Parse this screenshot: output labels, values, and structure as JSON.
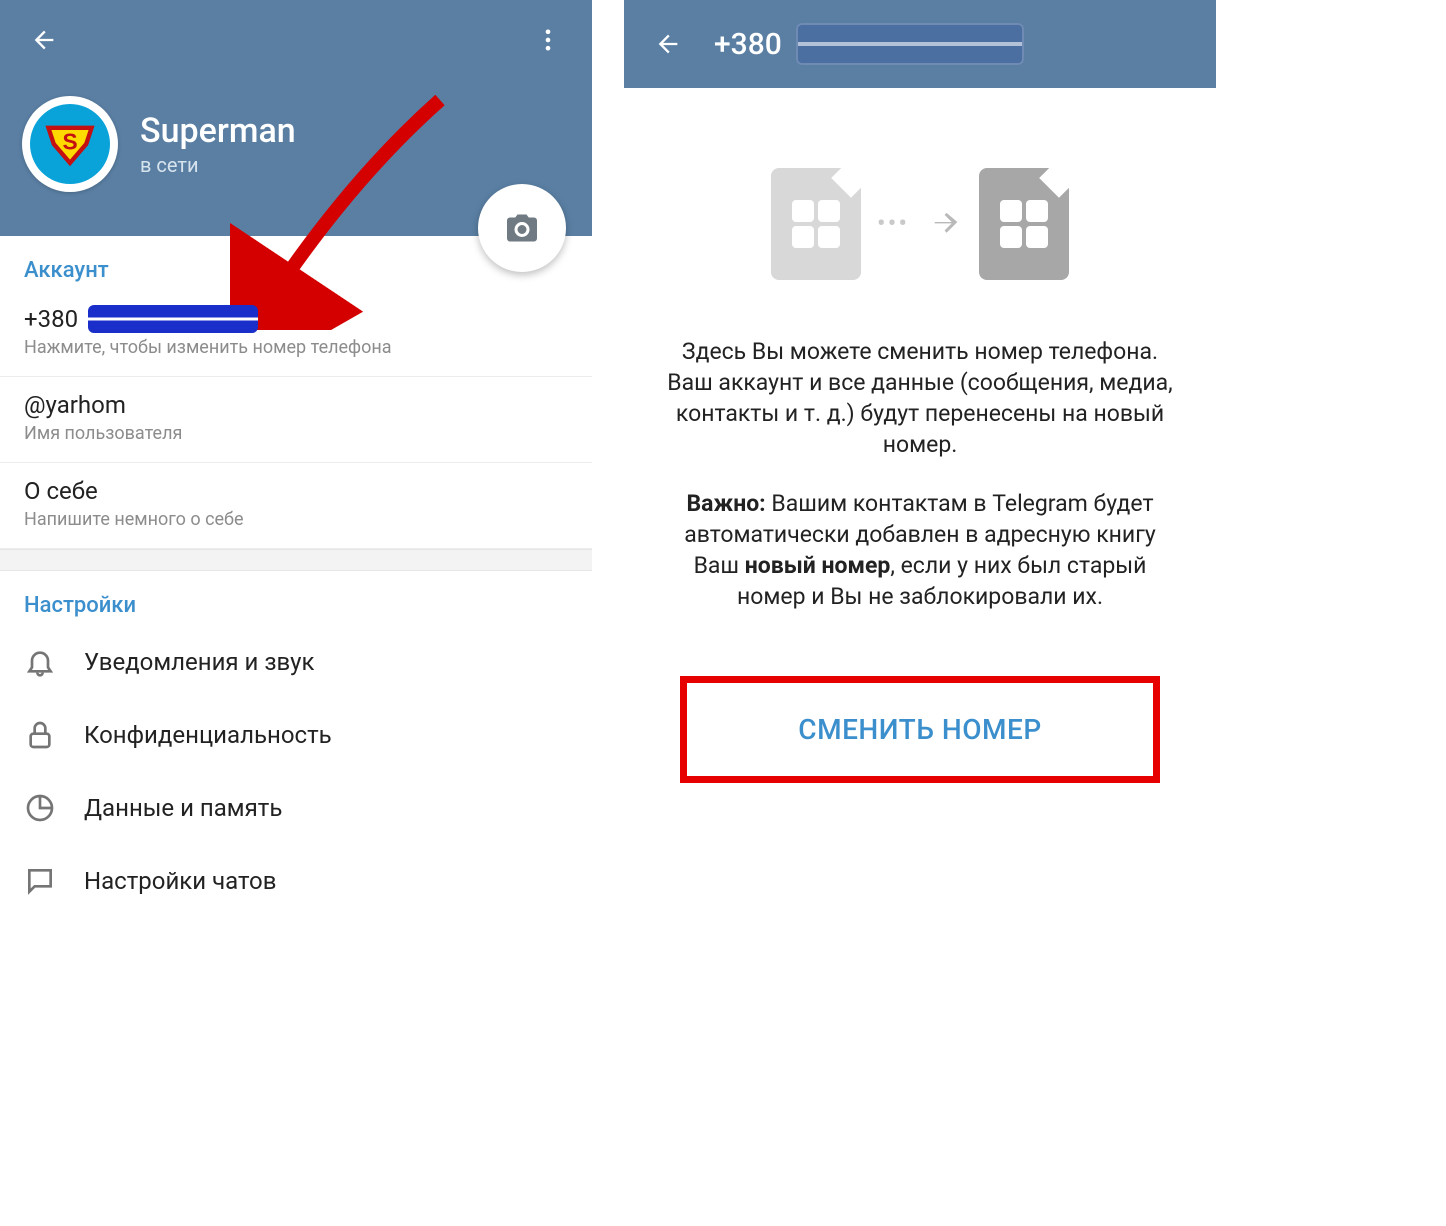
{
  "left": {
    "profile": {
      "name": "Superman",
      "status": "в сети"
    },
    "account": {
      "section_title": "Аккаунт",
      "phone_prefix": "+380",
      "phone_sub": "Нажмите, чтобы изменить номер телефона",
      "username": "@yarhom",
      "username_sub": "Имя пользователя",
      "bio_label": "О себе",
      "bio_sub": "Напишите немного о себе"
    },
    "settings": {
      "section_title": "Настройки",
      "items": [
        "Уведомления и звук",
        "Конфиденциальность",
        "Данные и память",
        "Настройки чатов"
      ]
    }
  },
  "right": {
    "phone_prefix": "+380",
    "body": {
      "p1": "Здесь Вы можете сменить номер телефона. Ваш аккаунт и все данные (сообщения, медиа, контакты и т. д.) будут перенесены на новый номер.",
      "important_label": "Важно:",
      "p2a": " Вашим контактам в Telegram будет автоматически добавлен в адресную книгу Ваш ",
      "p2_bold": "новый номер",
      "p2b": ", если у них был старый номер и Вы не заблокировали их."
    },
    "button_label": "СМЕНИТЬ НОМЕР"
  }
}
